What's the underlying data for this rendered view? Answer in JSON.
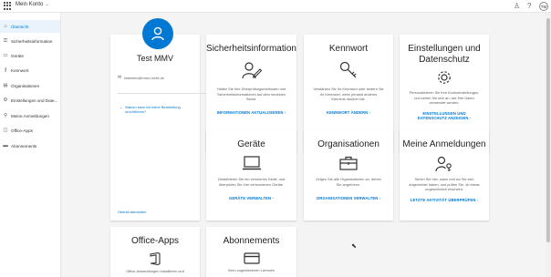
{
  "topbar": {
    "title": "Mein Konto",
    "avatar_initials": "TM"
  },
  "sidebar": {
    "items": [
      {
        "label": "Übersicht",
        "icon": "home-icon"
      },
      {
        "label": "Sicherheitsinformation",
        "icon": "key-icon"
      },
      {
        "label": "Geräte",
        "icon": "laptop-icon"
      },
      {
        "label": "Kennwort",
        "icon": "lock-icon"
      },
      {
        "label": "Organisationen",
        "icon": "briefcase-icon"
      },
      {
        "label": "Einstellungen und Date...",
        "icon": "gear-icon"
      },
      {
        "label": "Meine Anmeldungen",
        "icon": "person-key-icon"
      },
      {
        "label": "Office-Apps",
        "icon": "office-icon"
      },
      {
        "label": "Abonnements",
        "icon": "card-icon"
      }
    ]
  },
  "profile": {
    "name": "Test MMV",
    "email": "testmmv@mmv-recht.de",
    "why_text": "Warum kann ich keine Bearbeitung durchführen?",
    "signout": "Überall abmelden"
  },
  "cards": {
    "security": {
      "title": "Sicherheitsinformation",
      "text": "Halten Sie Ihre Überprüfungsmethoden und Sicherheitsinformationen auf dem neuesten Stand.",
      "link": "INFORMATIONEN AKTUALISIEREN"
    },
    "password": {
      "title": "Kennwort",
      "text": "Verstärken Sie Ihr Kennwort oder ändern Sie Ihr Kennwort, wenn jemand anderes Kenntnis darüber hat.",
      "link": "KENNWORT ÄNDERN"
    },
    "settings": {
      "title_line1": "Einstellungen und",
      "title_line2": "Datenschutz",
      "text": "Personalisieren Sie Ihre Kontoeinstellungen, und sehen Sie sich an, wie Ihre Daten verwendet werden.",
      "link_line1": "EINSTELLUNGEN UND",
      "link_line2": "DATENSCHUTZ ANZEIGEN"
    },
    "devices": {
      "title": "Geräte",
      "text": "Deaktivieren Sie ein verlorenes Gerät, und überprüfen Sie Ihre verbundenen Geräte.",
      "link": "GERÄTE VERWALTEN"
    },
    "organizations": {
      "title": "Organisationen",
      "text": "Zeigen Sie alle Organisationen an, denen Sie angehören.",
      "link": "ORGANISATIONEN VERWALTEN"
    },
    "signins": {
      "title": "Meine Anmeldungen",
      "text": "Sehen Sie hier, wann und wo Sie sich angemeldet haben, und prüfen Sie, ob etwas ungewöhnlich erscheint.",
      "link": "LETZTE AKTIVITÄT ÜBERPRÜFEN"
    },
    "office": {
      "title": "Office-Apps",
      "text": "Office-Anwendungen installieren und"
    },
    "subscriptions": {
      "title": "Abonnements",
      "text": "Ihren zugewiesenen Lizenzen"
    }
  },
  "colors": {
    "accent": "#0078d4",
    "text": "#201f1e",
    "muted": "#605e5c",
    "background": "#f4f4f4"
  }
}
